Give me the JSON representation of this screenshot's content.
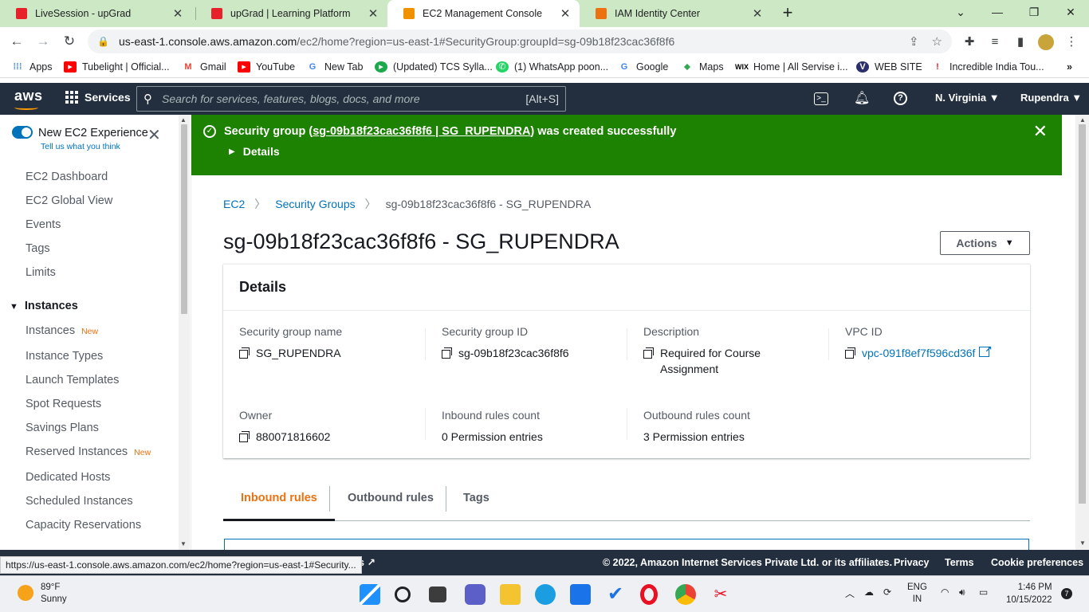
{
  "browser": {
    "tabs": [
      {
        "title": "LiveSession - upGrad",
        "favicon_color": "#e8202a",
        "active": false
      },
      {
        "title": "upGrad | Learning Platform",
        "favicon_color": "#e8202a",
        "active": false
      },
      {
        "title": "EC2 Management Console",
        "favicon_color": "#f29100",
        "active": true
      },
      {
        "title": "IAM Identity Center",
        "favicon_color": "#ec7211",
        "active": false
      }
    ],
    "url_host": "us-east-1.console.aws.amazon.com",
    "url_path": "/ec2/home?region=us-east-1#SecurityGroup:groupId=sg-09b18f23cac36f8f6",
    "bookmarks": [
      {
        "label": "Apps",
        "icon": "apps-grid-icon",
        "color": "#4285f4"
      },
      {
        "label": "Tubelight | Official...",
        "icon": "youtube-icon",
        "color": "#ff0000"
      },
      {
        "label": "Gmail",
        "icon": "gmail-icon",
        "color": "#ea4335"
      },
      {
        "label": "YouTube",
        "icon": "youtube-icon",
        "color": "#ff0000"
      },
      {
        "label": "New Tab",
        "icon": "google-icon",
        "color": "#4285f4"
      },
      {
        "label": "(Updated) TCS Sylla...",
        "icon": "tcs-icon",
        "color": "#1ca94c"
      },
      {
        "label": "(1) WhatsApp poon...",
        "icon": "whatsapp-icon",
        "color": "#25d366"
      },
      {
        "label": "Google",
        "icon": "google-icon",
        "color": "#4285f4"
      },
      {
        "label": "Maps",
        "icon": "maps-icon",
        "color": "#34a853"
      },
      {
        "label": "Home | All Servise i...",
        "icon": "wix-icon",
        "color": "#000000"
      },
      {
        "label": "WEB SITE",
        "icon": "website-icon",
        "color": "#2b2f6c"
      },
      {
        "label": "Incredible India Tou...",
        "icon": "india-icon",
        "color": "#e8202a"
      }
    ]
  },
  "aws_header": {
    "logo": "aws",
    "services": "Services",
    "search_placeholder": "Search for services, features, blogs, docs, and more",
    "search_shortcut": "[Alt+S]",
    "region": "N. Virginia",
    "user": "Rupendra"
  },
  "sidenav": {
    "experience_title": "New EC2 Experience",
    "experience_link": "Tell us what you think",
    "items_top": [
      "EC2 Dashboard",
      "EC2 Global View",
      "Events",
      "Tags",
      "Limits"
    ],
    "section_instances": "Instances",
    "instances_items": [
      {
        "label": "Instances",
        "badge": "New"
      },
      {
        "label": "Instance Types",
        "badge": ""
      },
      {
        "label": "Launch Templates",
        "badge": ""
      },
      {
        "label": "Spot Requests",
        "badge": ""
      },
      {
        "label": "Savings Plans",
        "badge": ""
      },
      {
        "label": "Reserved Instances",
        "badge": "New"
      },
      {
        "label": "Dedicated Hosts",
        "badge": ""
      },
      {
        "label": "Scheduled Instances",
        "badge": ""
      },
      {
        "label": "Capacity Reservations",
        "badge": ""
      }
    ]
  },
  "flash": {
    "prefix": "Security group (",
    "link": "sg-09b18f23cac36f8f6 | SG_RUPENDRA",
    "suffix": ") was created successfully",
    "details": "Details",
    "color": "#1d8102"
  },
  "breadcrumb": {
    "root": "EC2",
    "parent": "Security Groups",
    "current": "sg-09b18f23cac36f8f6 - SG_RUPENDRA"
  },
  "page": {
    "title": "sg-09b18f23cac36f8f6 - SG_RUPENDRA",
    "actions": "Actions"
  },
  "details": {
    "heading": "Details",
    "sg_name_label": "Security group name",
    "sg_name": "SG_RUPENDRA",
    "sg_id_label": "Security group ID",
    "sg_id": "sg-09b18f23cac36f8f6",
    "description_label": "Description",
    "description": "Required for Course Assignment",
    "vpc_label": "VPC ID",
    "vpc": "vpc-091f8ef7f596cd36f",
    "owner_label": "Owner",
    "owner": "880071816602",
    "inbound_label": "Inbound rules count",
    "inbound": "0 Permission entries",
    "outbound_label": "Outbound rules count",
    "outbound": "3 Permission entries"
  },
  "tabs": {
    "inbound": "Inbound rules",
    "outbound": "Outbound rules",
    "tags": "Tags"
  },
  "footer": {
    "copyright": "© 2022, Amazon Internet Services Private Ltd. or its affiliates.",
    "privacy": "Privacy",
    "terms": "Terms",
    "cookies": "Cookie preferences",
    "status_url": "https://us-east-1.console.aws.amazon.com/ec2/home?region=us-east-1#Security...",
    "hidden_suffix": "s"
  },
  "taskbar": {
    "temp": "89°F",
    "weather": "Sunny",
    "lang1": "ENG",
    "lang2": "IN",
    "time": "1:46 PM",
    "date": "10/15/2022",
    "notifications": "7"
  }
}
